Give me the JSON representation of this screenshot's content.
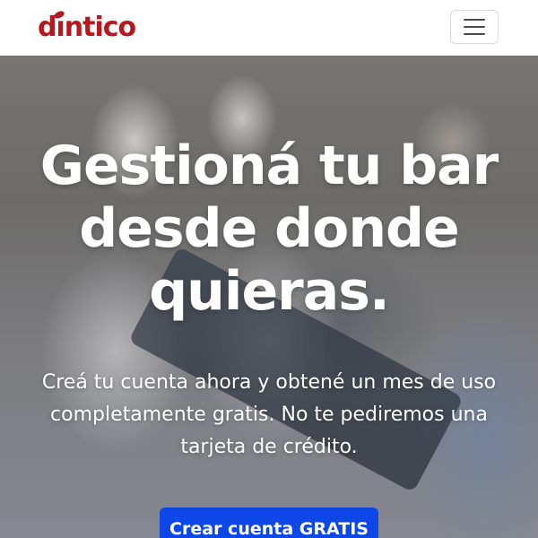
{
  "brand": {
    "logo_text": "dıntico",
    "logo_color": "#b5181e"
  },
  "navbar": {
    "menu_icon": "hamburger-menu-icon"
  },
  "hero": {
    "headline": "Gestioná tu bar desde donde quieras.",
    "subtext": "Creá tu cuenta ahora y obtené un mes de uso completamente gratis. No te pediremos una tarjeta de crédito.",
    "cta_label": "Crear cuenta GRATIS",
    "cta_color": "#0d47e8"
  }
}
